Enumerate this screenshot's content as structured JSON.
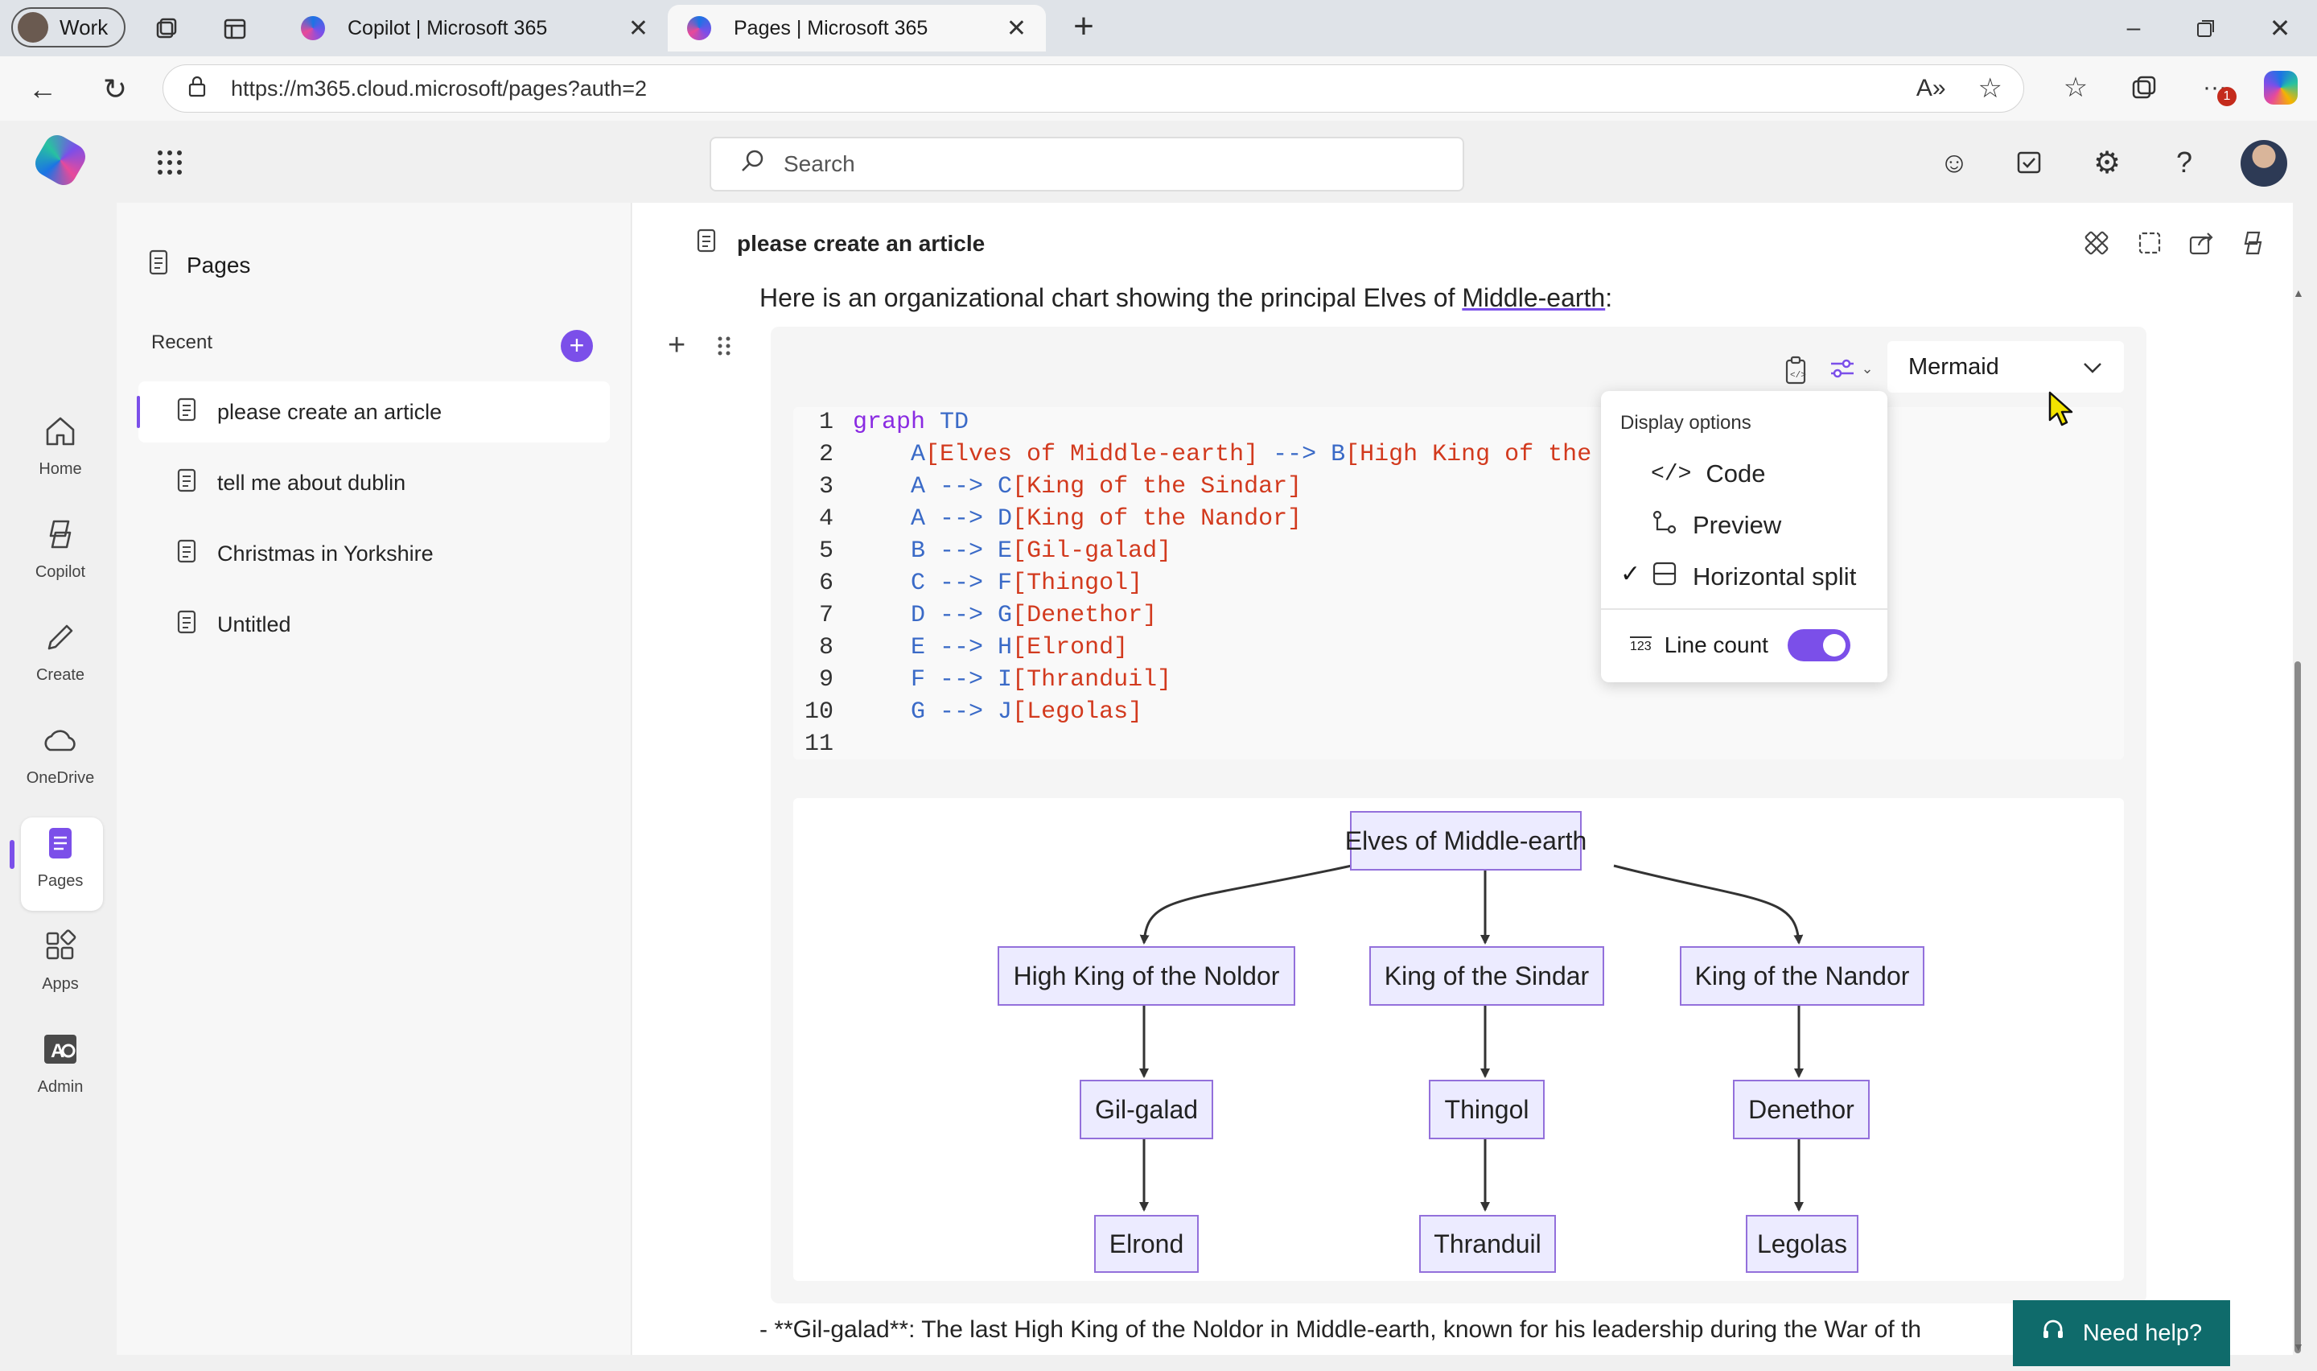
{
  "browser": {
    "profile": "Work",
    "tabs": [
      {
        "title": "Copilot | Microsoft 365"
      },
      {
        "title": "Pages | Microsoft 365"
      }
    ],
    "new_tab_glyph": "+",
    "url": "https://m365.cloud.microsoft/pages?auth=2",
    "notification_count": "1"
  },
  "search": {
    "placeholder": "Search"
  },
  "rail": [
    {
      "label": "Home",
      "icon": "home-icon"
    },
    {
      "label": "Copilot",
      "icon": "copilot-icon"
    },
    {
      "label": "Create",
      "icon": "pencil-icon"
    },
    {
      "label": "OneDrive",
      "icon": "cloud-icon"
    },
    {
      "label": "Pages",
      "icon": "pages-icon"
    },
    {
      "label": "Apps",
      "icon": "apps-icon"
    },
    {
      "label": "Admin",
      "icon": "admin-icon"
    }
  ],
  "side": {
    "title": "Pages",
    "recent_label": "Recent",
    "items": [
      {
        "label": "please create an article"
      },
      {
        "label": "tell me about dublin"
      },
      {
        "label": "Christmas in Yorkshire"
      },
      {
        "label": "Untitled"
      }
    ]
  },
  "page": {
    "title": "please create an article",
    "intro_prefix": "Here is an organizational chart showing the principal Elves of ",
    "intro_link": "Middle-earth",
    "intro_suffix": ":"
  },
  "code_block": {
    "language": "Mermaid",
    "lines": [
      {
        "n": "1",
        "kw": "graph",
        "rest": " TD"
      },
      {
        "n": "2",
        "id1": "A",
        "txt1": "[Elves of Middle-earth]",
        "arrow": " --> ",
        "id2": "B",
        "txt2": "[High King of the N"
      },
      {
        "n": "3",
        "id1": "A",
        "arrow": " --> ",
        "id2": "C",
        "txt2": "[King of the Sindar]"
      },
      {
        "n": "4",
        "id1": "A",
        "arrow": " --> ",
        "id2": "D",
        "txt2": "[King of the Nandor]"
      },
      {
        "n": "5",
        "id1": "B",
        "arrow": " --> ",
        "id2": "E",
        "txt2": "[Gil-galad]"
      },
      {
        "n": "6",
        "id1": "C",
        "arrow": " --> ",
        "id2": "F",
        "txt2": "[Thingol]"
      },
      {
        "n": "7",
        "id1": "D",
        "arrow": " --> ",
        "id2": "G",
        "txt2": "[Denethor]"
      },
      {
        "n": "8",
        "id1": "E",
        "arrow": " --> ",
        "id2": "H",
        "txt2": "[Elrond]"
      },
      {
        "n": "9",
        "id1": "F",
        "arrow": " --> ",
        "id2": "I",
        "txt2": "[Thranduil]"
      },
      {
        "n": "10",
        "id1": "G",
        "arrow": " --> ",
        "id2": "J",
        "txt2": "[Legolas]"
      },
      {
        "n": "11"
      }
    ]
  },
  "display_menu": {
    "heading": "Display options",
    "options": [
      {
        "label": "Code",
        "checked": false
      },
      {
        "label": "Preview",
        "checked": false
      },
      {
        "label": "Horizontal split",
        "checked": true
      }
    ],
    "line_count_label": "Line count",
    "line_count_on": true
  },
  "diagram": {
    "nodes": [
      {
        "id": "A",
        "label": "Elves of Middle-earth"
      },
      {
        "id": "B",
        "label": "High King of the Noldor"
      },
      {
        "id": "C",
        "label": "King of the Sindar"
      },
      {
        "id": "D",
        "label": "King of the Nandor"
      },
      {
        "id": "E",
        "label": "Gil-galad"
      },
      {
        "id": "F",
        "label": "Thingol"
      },
      {
        "id": "G",
        "label": "Denethor"
      },
      {
        "id": "H",
        "label": "Elrond"
      },
      {
        "id": "I",
        "label": "Thranduil"
      },
      {
        "id": "J",
        "label": "Legolas"
      }
    ]
  },
  "footer_text": "- **Gil-galad**: The last High King of the Noldor in Middle-earth, known for his leadership during the War of th",
  "need_help": "Need help?",
  "colors": {
    "accent": "#7b4fe9",
    "node_fill": "#ecebff",
    "node_border": "#9370db"
  }
}
